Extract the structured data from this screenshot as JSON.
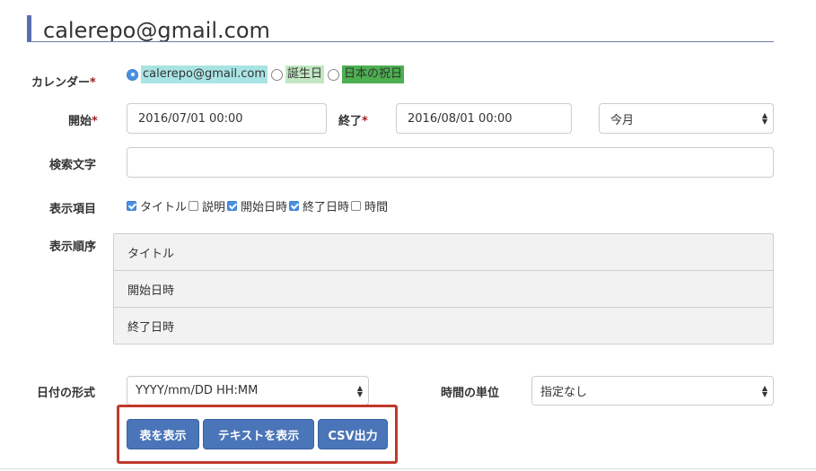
{
  "header": {
    "title": "calerepo@gmail.com"
  },
  "calendar": {
    "label": "カレンダー",
    "required_mark": "*",
    "options": [
      {
        "label": "calerepo@gmail.com",
        "checked": true,
        "bg": "#a9e4e4"
      },
      {
        "label": "誕生日",
        "checked": false,
        "bg": "#c1e8c3"
      },
      {
        "label": "日本の祝日",
        "checked": false,
        "bg": "#4caf50"
      }
    ]
  },
  "start": {
    "label": "開始",
    "required_mark": "*",
    "value": "2016/07/01 00:00"
  },
  "end": {
    "label": "終了",
    "required_mark": "*",
    "value": "2016/08/01 00:00"
  },
  "period": {
    "selected": "今月"
  },
  "search": {
    "label": "検索文字",
    "value": ""
  },
  "display_items": {
    "label": "表示項目",
    "options": [
      {
        "label": "タイトル",
        "checked": true
      },
      {
        "label": "説明",
        "checked": false
      },
      {
        "label": "開始日時",
        "checked": true
      },
      {
        "label": "終了日時",
        "checked": true
      },
      {
        "label": "時間",
        "checked": false
      }
    ]
  },
  "display_order": {
    "label": "表示順序",
    "items": [
      "タイトル",
      "開始日時",
      "終了日時"
    ]
  },
  "date_format": {
    "label": "日付の形式",
    "selected": "YYYY/mm/DD HH:MM"
  },
  "time_unit": {
    "label": "時間の単位",
    "selected": "指定なし"
  },
  "buttons": {
    "show_table": "表を表示",
    "show_text": "テキストを表示",
    "csv_export": "CSV出力"
  },
  "colors": {
    "accent": "#4a75b8",
    "highlight_border": "#c0392b",
    "title_bar": "#5a6fb0"
  }
}
